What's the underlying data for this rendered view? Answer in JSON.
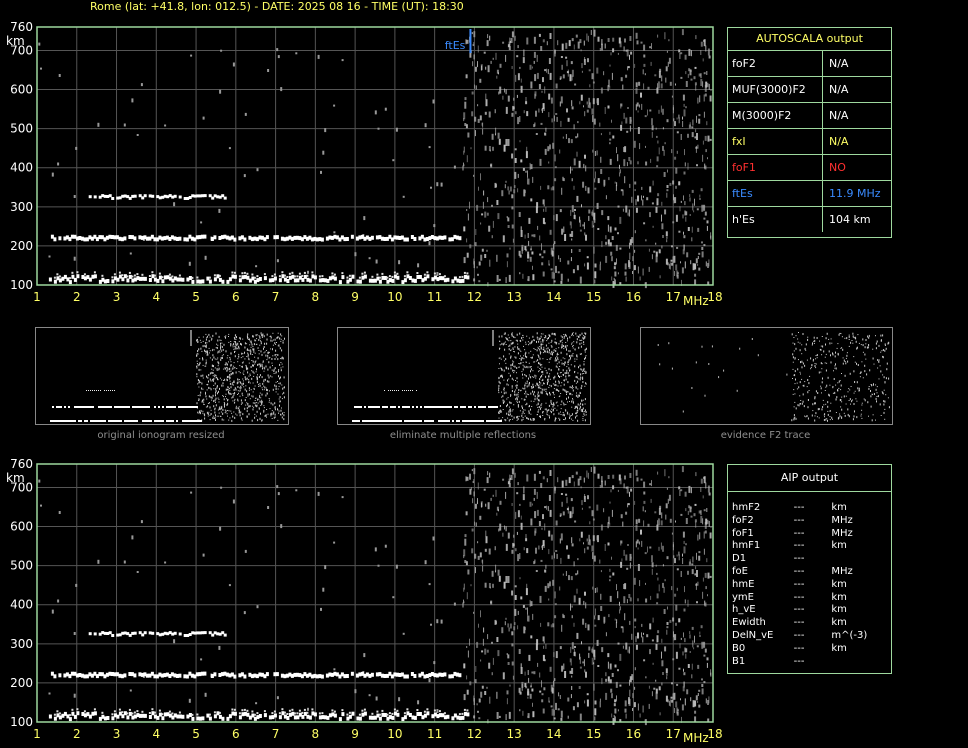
{
  "header": {
    "title": "Rome (lat: +41.8, lon: 012.5) - DATE: 2025 08 16 - TIME (UT): 18:30"
  },
  "colors": {
    "axis_labels": "#ffff66",
    "frame": "#9ed89e",
    "grid": "#555555",
    "trace": "#ffffff",
    "noise": "#bbbbbb",
    "es_marker": "#3a8bff",
    "no_value": "#ff3030"
  },
  "chart_data": [
    {
      "type": "scatter",
      "title": "",
      "xlabel": "MHz",
      "ylabel": "km",
      "x_ticks": [
        "1",
        "2",
        "3",
        "4",
        "5",
        "6",
        "7",
        "8",
        "9",
        "10",
        "11",
        "12",
        "13",
        "14",
        "15",
        "16",
        "17",
        "18"
      ],
      "y_ticks": [
        "100",
        "200",
        "300",
        "400",
        "500",
        "600",
        "700",
        "760"
      ],
      "xlim": [
        1,
        18
      ],
      "ylim": [
        100,
        760
      ],
      "grid": true,
      "annotation": {
        "label": "ftEs",
        "x": 11.9
      },
      "series": [
        {
          "x_start": 1.3,
          "x_end": 11.8,
          "y": 115
        },
        {
          "x_start": 1.35,
          "x_end": 11.7,
          "y": 220
        },
        {
          "x_start": 2.3,
          "x_end": 5.7,
          "y": 325
        }
      ]
    },
    {
      "type": "scatter",
      "title": "",
      "xlabel": "MHz",
      "ylabel": "km",
      "x_ticks": [
        "1",
        "2",
        "3",
        "4",
        "5",
        "6",
        "7",
        "8",
        "9",
        "10",
        "11",
        "12",
        "13",
        "14",
        "15",
        "16",
        "17",
        "18"
      ],
      "y_ticks": [
        "100",
        "200",
        "300",
        "400",
        "500",
        "600",
        "700",
        "760"
      ],
      "xlim": [
        1,
        18
      ],
      "ylim": [
        100,
        760
      ],
      "grid": true,
      "series": [
        {
          "x_start": 1.3,
          "x_end": 11.8,
          "y": 115
        },
        {
          "x_start": 1.35,
          "x_end": 11.7,
          "y": 220
        },
        {
          "x_start": 2.3,
          "x_end": 5.7,
          "y": 325
        }
      ]
    }
  ],
  "autoscala": {
    "title": "AUTOSCALA output",
    "rows": [
      {
        "key": "foF2",
        "value": "N/A",
        "color": "#ffffff",
        "vcolor": "#ffffff"
      },
      {
        "key": "MUF(3000)F2",
        "value": "N/A",
        "color": "#ffffff",
        "vcolor": "#ffffff"
      },
      {
        "key": "M(3000)F2",
        "value": "N/A",
        "color": "#ffffff",
        "vcolor": "#ffffff"
      },
      {
        "key": "fxI",
        "value": "N/A",
        "color": "#ffff66",
        "vcolor": "#ffff66"
      },
      {
        "key": "foF1",
        "value": "NO",
        "color": "#ff3030",
        "vcolor": "#ff3030"
      },
      {
        "key": "ftEs",
        "value": "11.9 MHz",
        "color": "#3a8bff",
        "vcolor": "#3a8bff"
      },
      {
        "key": "h'Es",
        "value": "104     km",
        "color": "#ffffff",
        "vcolor": "#ffffff"
      }
    ]
  },
  "aip": {
    "title": "AIP output",
    "rows": [
      {
        "key": "hmF2",
        "value": "---",
        "unit": "km"
      },
      {
        "key": "foF2",
        "value": "---",
        "unit": "MHz"
      },
      {
        "key": "foF1",
        "value": "---",
        "unit": "MHz"
      },
      {
        "key": "hmF1",
        "value": "---",
        "unit": "km"
      },
      {
        "key": "D1",
        "value": "---",
        "unit": ""
      },
      {
        "key": "foE",
        "value": "---",
        "unit": "MHz"
      },
      {
        "key": "hmE",
        "value": "---",
        "unit": "km"
      },
      {
        "key": "ymE",
        "value": "---",
        "unit": "km"
      },
      {
        "key": "h_vE",
        "value": "---",
        "unit": "km"
      },
      {
        "key": "Ewidth",
        "value": "---",
        "unit": "km"
      },
      {
        "key": "DelN_vE",
        "value": "---",
        "unit": "m^(-3)"
      },
      {
        "key": "B0",
        "value": "---",
        "unit": "km"
      },
      {
        "key": "B1",
        "value": "---",
        "unit": ""
      }
    ]
  },
  "thumbnails": [
    {
      "caption": "original ionogram resized"
    },
    {
      "caption": "eliminate multiple reflections"
    },
    {
      "caption": "evidence F2 trace"
    }
  ]
}
